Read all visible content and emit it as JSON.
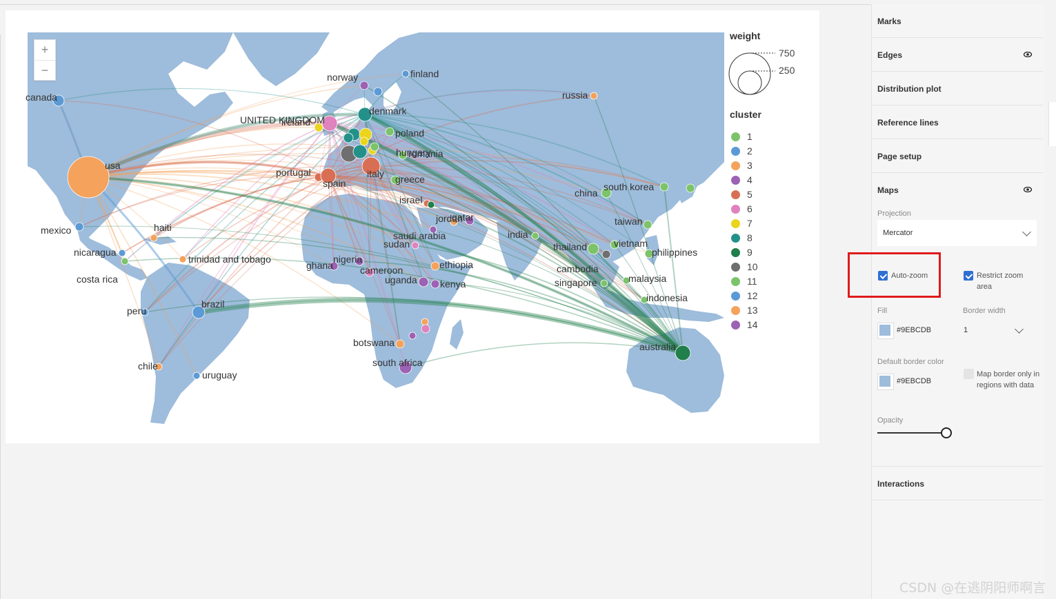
{
  "map": {
    "zoom_in": "+",
    "zoom_out": "−",
    "land_color": "#9EBCDB",
    "labels": [
      {
        "text": "canada",
        "anchor": "canada"
      },
      {
        "text": "usa",
        "anchor": "usa"
      },
      {
        "text": "mexico",
        "anchor": "mexico"
      },
      {
        "text": "nicaragua",
        "anchor": "nicaragua"
      },
      {
        "text": "costa rica",
        "anchor": "costarica"
      },
      {
        "text": "haiti",
        "anchor": "haiti"
      },
      {
        "text": "trinidad and tobago",
        "anchor": "trinidad"
      },
      {
        "text": "peru",
        "anchor": "peru"
      },
      {
        "text": "brazil",
        "anchor": "brazil"
      },
      {
        "text": "chile",
        "anchor": "chile"
      },
      {
        "text": "uruguay",
        "anchor": "uruguay"
      },
      {
        "text": "norway",
        "anchor": "norway"
      },
      {
        "text": "finland",
        "anchor": "finland"
      },
      {
        "text": "denmark",
        "anchor": "denmark"
      },
      {
        "text": "UNITED KINGDOM",
        "anchor": "uk"
      },
      {
        "text": "ireland",
        "anchor": "ireland"
      },
      {
        "text": "poland",
        "anchor": "poland"
      },
      {
        "text": "hungary",
        "anchor": "hungary"
      },
      {
        "text": "romania",
        "anchor": "romania"
      },
      {
        "text": "portugal",
        "anchor": "portugal"
      },
      {
        "text": "spain",
        "anchor": "spain"
      },
      {
        "text": "italy",
        "anchor": "italy"
      },
      {
        "text": "greece",
        "anchor": "greece"
      },
      {
        "text": "israel",
        "anchor": "israel"
      },
      {
        "text": "jordan",
        "anchor": "jordan"
      },
      {
        "text": "qatar",
        "anchor": "qatar"
      },
      {
        "text": "saudi arabia",
        "anchor": "saudi"
      },
      {
        "text": "sudan",
        "anchor": "sudan"
      },
      {
        "text": "ethiopia",
        "anchor": "ethiopia"
      },
      {
        "text": "kenya",
        "anchor": "kenya"
      },
      {
        "text": "uganda",
        "anchor": "uganda"
      },
      {
        "text": "cameroon",
        "anchor": "cameroon"
      },
      {
        "text": "nigeria",
        "anchor": "nigeria"
      },
      {
        "text": "ghana",
        "anchor": "ghana"
      },
      {
        "text": "botswana",
        "anchor": "botswana"
      },
      {
        "text": "south africa",
        "anchor": "southafrica"
      },
      {
        "text": "russia",
        "anchor": "russia"
      },
      {
        "text": "india",
        "anchor": "india"
      },
      {
        "text": "china",
        "anchor": "china"
      },
      {
        "text": "south korea",
        "anchor": "southkorea"
      },
      {
        "text": "taiwan",
        "anchor": "taiwan"
      },
      {
        "text": "vietnam",
        "anchor": "vietnam"
      },
      {
        "text": "philippines",
        "anchor": "philippines"
      },
      {
        "text": "thailand",
        "anchor": "thailand"
      },
      {
        "text": "cambodia",
        "anchor": "cambodia"
      },
      {
        "text": "singapore",
        "anchor": "singapore"
      },
      {
        "text": "malaysia",
        "anchor": "malaysia"
      },
      {
        "text": "indonesia",
        "anchor": "indonesia"
      },
      {
        "text": "australia",
        "anchor": "australia"
      }
    ]
  },
  "legend": {
    "weight_title": "weight",
    "weight_values": [
      "750",
      "250"
    ],
    "cluster_title": "cluster",
    "clusters": [
      {
        "label": "1",
        "color": "#7cc36a"
      },
      {
        "label": "2",
        "color": "#5b9ad6"
      },
      {
        "label": "3",
        "color": "#f4a25c"
      },
      {
        "label": "4",
        "color": "#9c62b3"
      },
      {
        "label": "5",
        "color": "#d86f55"
      },
      {
        "label": "6",
        "color": "#df82bd"
      },
      {
        "label": "7",
        "color": "#ebd41c"
      },
      {
        "label": "8",
        "color": "#23918a"
      },
      {
        "label": "9",
        "color": "#217f4c"
      },
      {
        "label": "10",
        "color": "#6f6f6f"
      },
      {
        "label": "11",
        "color": "#7cc36a"
      },
      {
        "label": "12",
        "color": "#5b9ad6"
      },
      {
        "label": "13",
        "color": "#f4a25c"
      },
      {
        "label": "14",
        "color": "#9c62b3"
      }
    ]
  },
  "panel": {
    "sections": {
      "marks": "Marks",
      "edges": "Edges",
      "distribution": "Distribution plot",
      "reference": "Reference lines",
      "page_setup": "Page setup",
      "maps": "Maps",
      "interactions": "Interactions"
    },
    "maps": {
      "projection_label": "Projection",
      "projection_value": "Mercator",
      "auto_zoom": "Auto-zoom",
      "restrict_zoom": "Restrict zoom area",
      "fill_label": "Fill",
      "fill_value": "#9EBCDB",
      "border_width_label": "Border width",
      "border_width_value": "1",
      "default_border_color_label": "Default border color",
      "default_border_color_value": "#9EBCDB",
      "map_border_only": "Map border only in regions with data",
      "opacity_label": "Opacity",
      "opacity_value": 1
    }
  },
  "watermark": "CSDN @在逃阴阳师啊言"
}
